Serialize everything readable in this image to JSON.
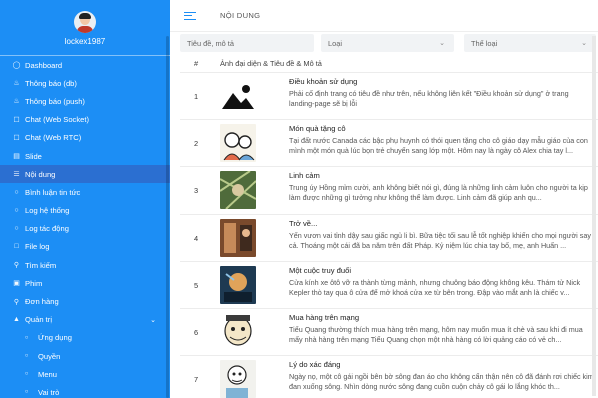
{
  "user": {
    "name": "lockex1987"
  },
  "sidebar": {
    "items": [
      {
        "label": "Dashboard",
        "icon": "dashboard-icon"
      },
      {
        "label": "Thông báo (db)",
        "icon": "bell-icon"
      },
      {
        "label": "Thông báo (push)",
        "icon": "bell-icon"
      },
      {
        "label": "Chat (Web Socket)",
        "icon": "chat-icon"
      },
      {
        "label": "Chat (Web RTC)",
        "icon": "chat-icon"
      },
      {
        "label": "Slide",
        "icon": "slides-icon"
      },
      {
        "label": "Nội dung",
        "icon": "document-icon",
        "active": true
      },
      {
        "label": "Bình luận tin tức",
        "icon": "comment-icon"
      },
      {
        "label": "Log hệ thống",
        "icon": "log-icon"
      },
      {
        "label": "Log tác động",
        "icon": "log-icon"
      },
      {
        "label": "File log",
        "icon": "file-icon"
      },
      {
        "label": "Tìm kiếm",
        "icon": "search-icon"
      },
      {
        "label": "Phim",
        "icon": "film-icon"
      },
      {
        "label": "Đơn hàng",
        "icon": "cart-icon"
      },
      {
        "label": "Quản trị",
        "icon": "admin-icon",
        "expanded": true
      },
      {
        "label": "Ứng dụng",
        "icon": "circle-icon",
        "sub": true
      },
      {
        "label": "Quyền",
        "icon": "circle-icon",
        "sub": true
      },
      {
        "label": "Menu",
        "icon": "circle-icon",
        "sub": true
      },
      {
        "label": "Vai trò",
        "icon": "circle-icon",
        "sub": true
      }
    ]
  },
  "header": {
    "title": "NỘI DUNG"
  },
  "filters": {
    "search_placeholder": "Tiêu đề, mô tả",
    "type_placeholder": "Loại",
    "category_placeholder": "Thể loại"
  },
  "table": {
    "columns": [
      "#",
      "Ảnh đại diện & Tiêu đề & Mô tả"
    ],
    "rows": [
      {
        "num": "1",
        "title": "Điều khoản sử dụng",
        "desc": "Phải cố định trang có tiêu đề như trên, nếu không liên kết \"Điều khoản sử dụng\" ở trang landing-page sẽ bị lỗi"
      },
      {
        "num": "2",
        "title": "Món quà tặng cô",
        "desc": "Tại đất nước Canada các bậc phụ huynh có thói quen tặng cho cô giáo dạy mẫu giáo của con mình một món quà lúc bọn trẻ chuyển sang lớp một. Hôm nay là ngày cô Alex chia tay l..."
      },
      {
        "num": "3",
        "title": "Linh cảm",
        "desc": "Trung úy Hồng mỉm cười, anh không biết nói gì, đúng là những linh cảm luôn cho người ta kịp làm được những gì tưởng như không thể làm được. Linh cảm đã giúp anh qu..."
      },
      {
        "num": "4",
        "title": "Trở về...",
        "desc": "Yến vươn vai tỉnh dậy sau giấc ngủ li bì. Bữa tiệc tối sau lễ tốt nghiệp khiến cho mọi người say cả. Thoáng một cái đã ba năm trên đất Pháp. Kỷ niệm lúc chia tay bố, mẹ, anh Huấn ..."
      },
      {
        "num": "5",
        "title": "Một cuộc truy đuổi",
        "desc": "Cửa kính xe ôtô vỡ ra thành từng mảnh, nhưng chuông báo động không kêu. Thám tử Nick Kepler thò tay qua ô cửa để mở khoá cửa xe từ bên trong. Đập vào mắt anh là chiếc v..."
      },
      {
        "num": "6",
        "title": "Mua hàng trên mạng",
        "desc": "Tiểu Quang thường thích mua hàng trên mạng, hôm nay muốn mua ít chè và sau khi đi mua mấy nhà hàng trên mạng Tiểu Quang chọn một nhà hàng có lời quảng cáo có vẻ ch..."
      },
      {
        "num": "7",
        "title": "Lý do xác đáng",
        "desc": "Ngày nọ, một cô gái ngồi bên bờ sông đan áo cho không cẩn thận nên cô đã đánh rơi chiếc kim đan xuống sông. Nhìn dòng nước sông đang cuồn cuộn chảy cô gái lo lắng khóc th..."
      }
    ]
  },
  "colors": {
    "sidebar_bg": "#1c8ef5",
    "active_bg": "#2b6fd1"
  }
}
